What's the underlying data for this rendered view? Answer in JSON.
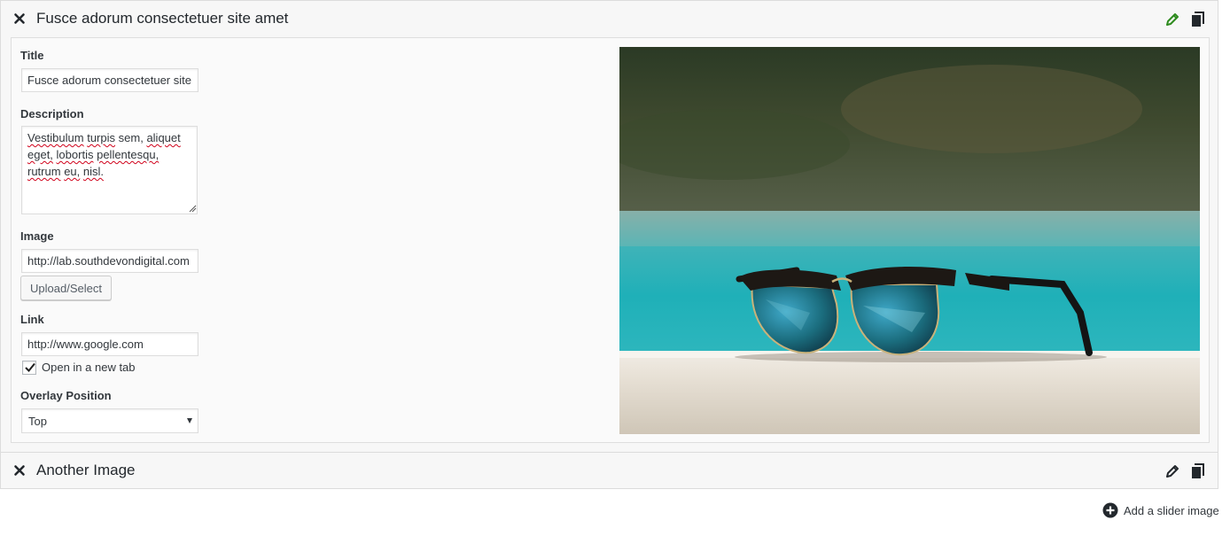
{
  "slides": [
    {
      "title": "Fusce adorum consectetuer site amet",
      "fields": {
        "title_label": "Title",
        "title_value": "Fusce adorum consectetuer site amet",
        "description_label": "Description",
        "description_words": [
          "Vestibulum",
          "turpis",
          "sem,",
          "aliquet",
          "eget,",
          "lobortis",
          "pellentesqu,",
          "rutrum",
          "eu,",
          "nisl."
        ],
        "image_label": "Image",
        "image_value": "http://lab.southdevondigital.com",
        "upload_button": "Upload/Select",
        "link_label": "Link",
        "link_value": "http://www.google.com",
        "new_tab_label": "Open in a new tab",
        "new_tab_checked": true,
        "overlay_label": "Overlay Position",
        "overlay_value": "Top"
      },
      "edit_icon": "pencil-icon",
      "edit_icon_color": "#2e8b1f",
      "copy_icon": "copy-icon",
      "close_icon": "close-icon",
      "preview_image": "sunglasses-on-pool-ledge"
    },
    {
      "title": "Another Image",
      "edit_icon": "pencil-icon",
      "copy_icon": "copy-icon",
      "close_icon": "close-icon"
    }
  ],
  "add_slide": {
    "label": "Add a slider image",
    "icon": "plus-circle-icon"
  },
  "colors": {
    "active_edit": "#2e8b1f",
    "text": "#23282d",
    "border": "#dcdcdc"
  }
}
